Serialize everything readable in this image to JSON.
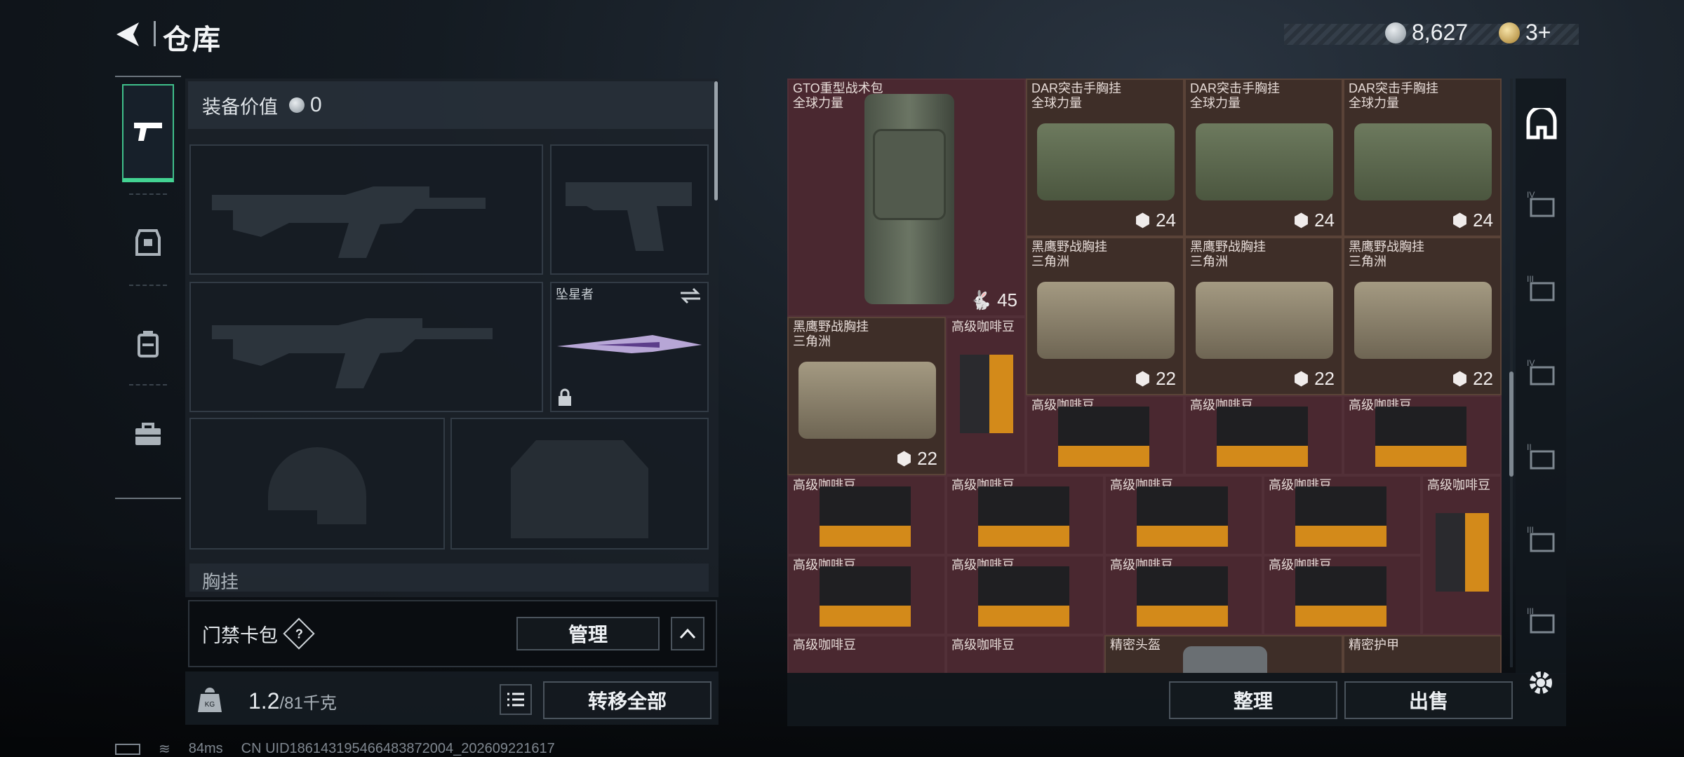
{
  "header": {
    "title": "仓库",
    "currency_silver": "8,627",
    "currency_gold": "3+"
  },
  "equipment": {
    "value_label": "装备价值",
    "value": "0",
    "melee_name": "坠星者",
    "section_partial": "胸挂",
    "access_card_label": "门禁卡包",
    "help": "?",
    "manage_button": "管理",
    "weight_current": "1.2",
    "weight_max": "/81千克",
    "transfer_all_button": "转移全部"
  },
  "inventory": {
    "items": [
      {
        "name": "GTO重型战术包",
        "sub": "全球力量",
        "count": "45"
      },
      {
        "name": "DAR突击手胸挂",
        "sub": "全球力量",
        "count": "24"
      },
      {
        "name": "DAR突击手胸挂",
        "sub": "全球力量",
        "count": "24"
      },
      {
        "name": "DAR突击手胸挂",
        "sub": "全球力量",
        "count": "24"
      },
      {
        "name": "黑鹰野战胸挂",
        "sub": "三角洲",
        "count": "22"
      },
      {
        "name": "黑鹰野战胸挂",
        "sub": "三角洲",
        "count": "22"
      },
      {
        "name": "黑鹰野战胸挂",
        "sub": "三角洲",
        "count": "22"
      },
      {
        "name": "黑鹰野战胸挂",
        "sub": "三角洲",
        "count": "22"
      },
      {
        "name": "高级咖啡豆"
      },
      {
        "name": "精密头盔"
      },
      {
        "name": "精密护甲"
      }
    ],
    "sort_button": "整理",
    "sell_button": "出售"
  },
  "status_bar": {
    "ping": "84ms",
    "uid": "CN UID18614319546648387200​4_202609221617"
  },
  "colors": {
    "accent_green": "#43d392",
    "grid_red": "#4a2830",
    "grid_brown": "#3e2e28"
  }
}
